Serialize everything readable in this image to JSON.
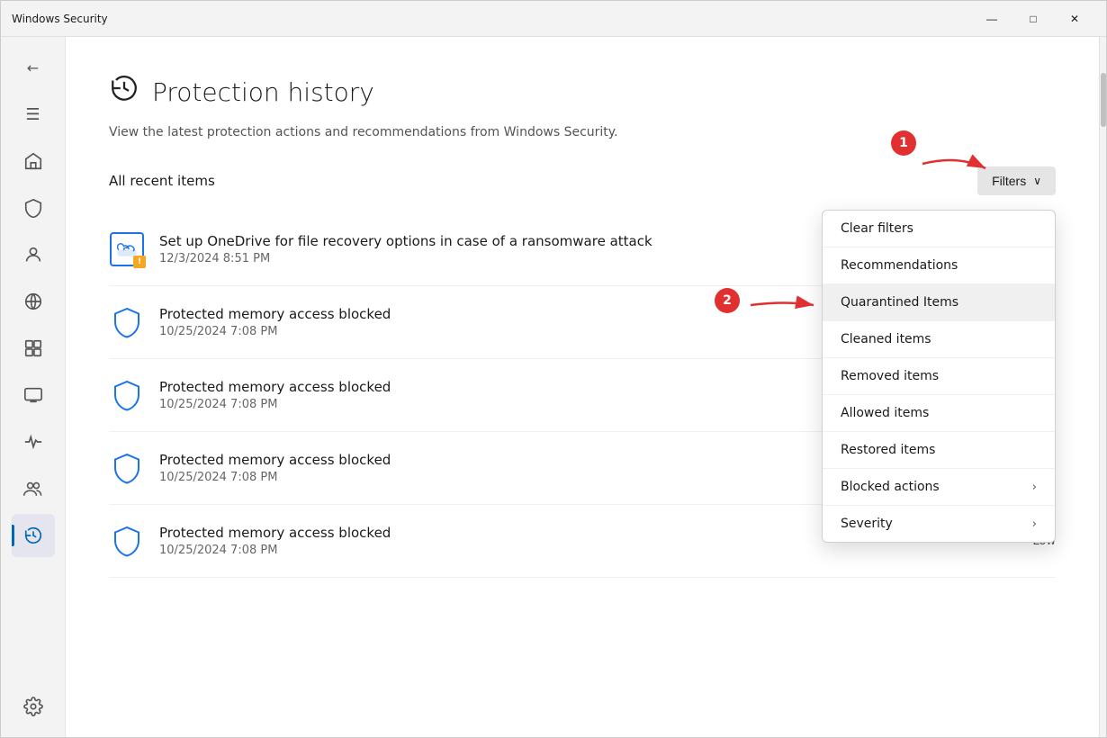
{
  "window": {
    "title": "Windows Security",
    "controls": {
      "minimize": "—",
      "maximize": "□",
      "close": "✕"
    }
  },
  "sidebar": {
    "icons": [
      {
        "name": "back-icon",
        "symbol": "←",
        "active": false
      },
      {
        "name": "menu-icon",
        "symbol": "☰",
        "active": false
      },
      {
        "name": "home-icon",
        "symbol": "⌂",
        "active": false
      },
      {
        "name": "shield-nav-icon",
        "symbol": "🛡",
        "active": false
      },
      {
        "name": "person-icon",
        "symbol": "👤",
        "active": false
      },
      {
        "name": "network-icon",
        "symbol": "📡",
        "active": false
      },
      {
        "name": "app-icon",
        "symbol": "▭",
        "active": false
      },
      {
        "name": "device-icon",
        "symbol": "💻",
        "active": false
      },
      {
        "name": "health-icon",
        "symbol": "♥",
        "active": false
      },
      {
        "name": "family-icon",
        "symbol": "👥",
        "active": false
      },
      {
        "name": "history-icon",
        "symbol": "🕐",
        "active": true
      },
      {
        "name": "settings-icon",
        "symbol": "⚙",
        "active": false
      }
    ]
  },
  "page": {
    "title": "Protection history",
    "subtitle": "View the latest protection actions and recommendations from Windows Security.",
    "list_label": "All recent items"
  },
  "filters_button": {
    "label": "Filters",
    "chevron": "∨"
  },
  "dropdown": {
    "items": [
      {
        "label": "Clear filters",
        "has_arrow": false,
        "highlighted": false
      },
      {
        "label": "Recommendations",
        "has_arrow": false,
        "highlighted": false
      },
      {
        "label": "Quarantined Items",
        "has_arrow": false,
        "highlighted": true
      },
      {
        "label": "Cleaned items",
        "has_arrow": false,
        "highlighted": false
      },
      {
        "label": "Removed items",
        "has_arrow": false,
        "highlighted": false
      },
      {
        "label": "Allowed items",
        "has_arrow": false,
        "highlighted": false
      },
      {
        "label": "Restored items",
        "has_arrow": false,
        "highlighted": false
      },
      {
        "label": "Blocked actions",
        "has_arrow": true,
        "highlighted": false
      },
      {
        "label": "Severity",
        "has_arrow": true,
        "highlighted": false
      }
    ]
  },
  "list_items": [
    {
      "title": "Set up OneDrive for file recovery options in case of a ransomware attack",
      "date": "12/3/2024 8:51 PM",
      "icon_type": "onedrive"
    },
    {
      "title": "Protected memory access blocked",
      "date": "10/25/2024 7:08 PM",
      "icon_type": "shield"
    },
    {
      "title": "Protected memory access blocked",
      "date": "10/25/2024 7:08 PM",
      "icon_type": "shield"
    },
    {
      "title": "Protected memory access blocked",
      "date": "10/25/2024 7:08 PM",
      "icon_type": "shield"
    },
    {
      "title": "Protected memory access blocked",
      "date": "10/25/2024 7:08 PM",
      "icon_type": "shield"
    }
  ],
  "annotations": [
    {
      "number": "1",
      "label": "Filters button annotation"
    },
    {
      "number": "2",
      "label": "Quarantined Items annotation"
    }
  ],
  "low_badge": "Low"
}
